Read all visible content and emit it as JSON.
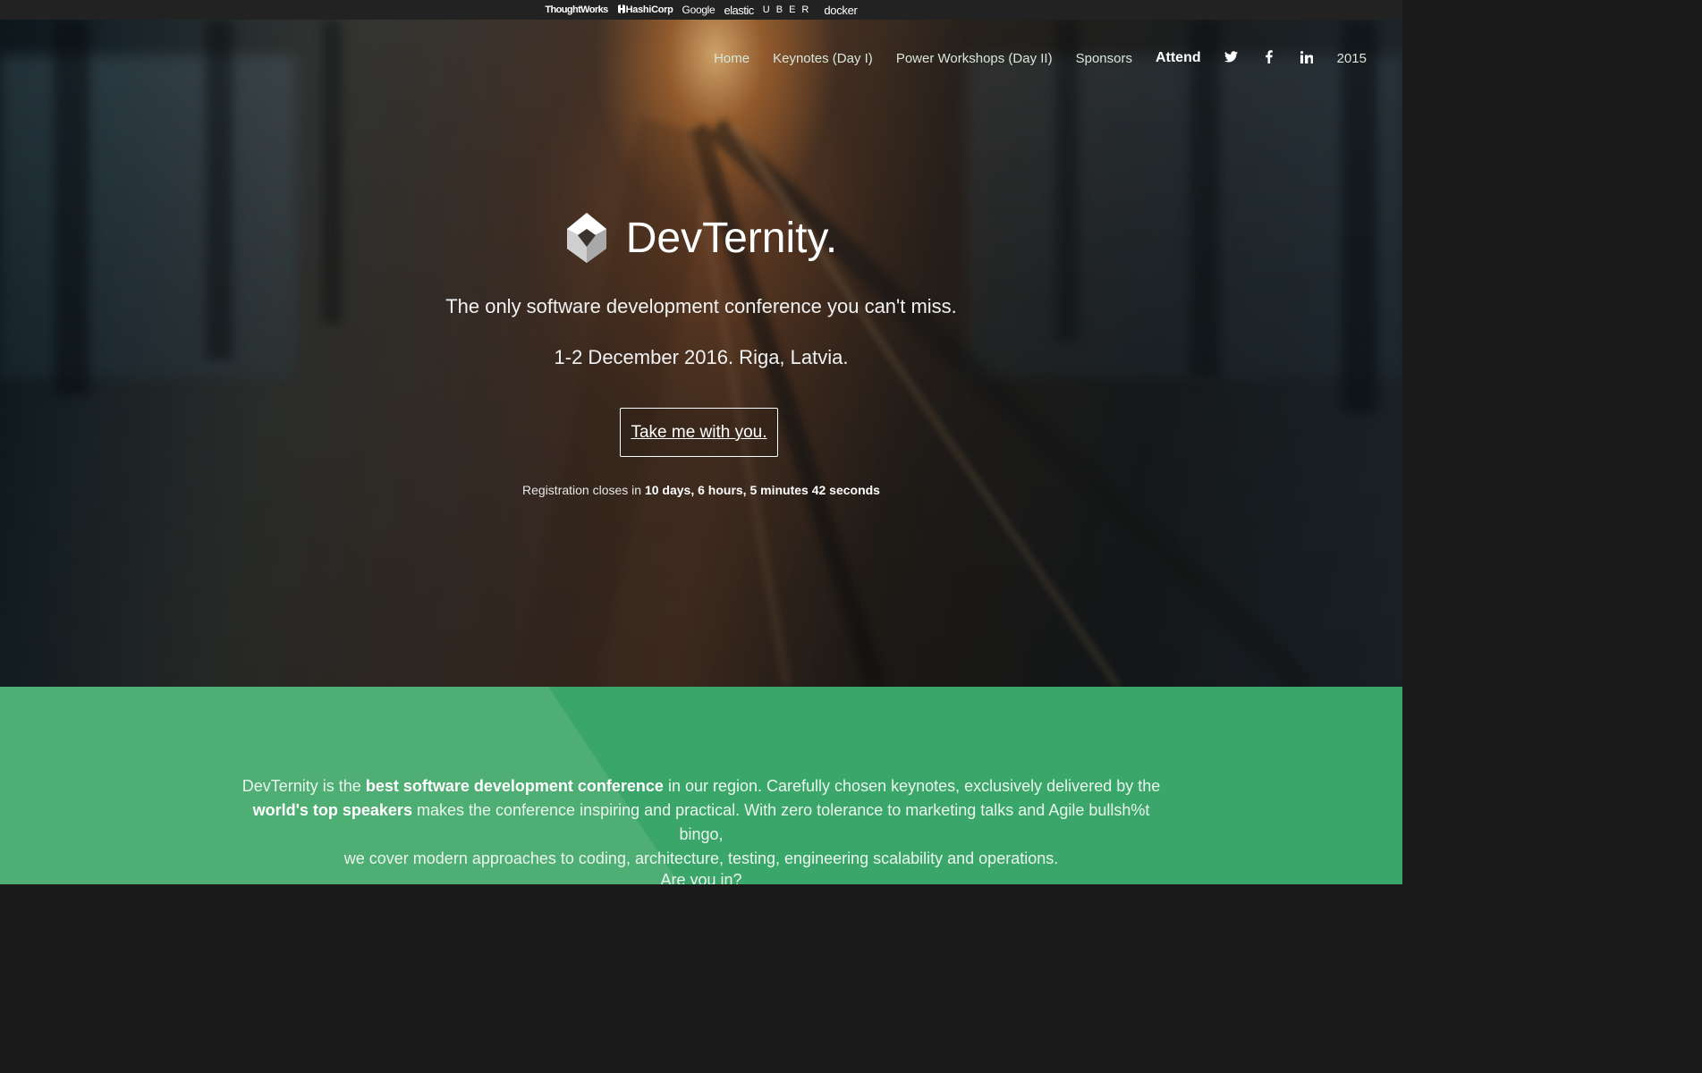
{
  "sponsors": {
    "thoughtworks": "ThoughtWorks",
    "hashicorp": "HashiCorp",
    "google": "Google",
    "elastic": "elastic",
    "uber": "UBER",
    "docker": "docker"
  },
  "nav": {
    "home": "Home",
    "keynotes": "Keynotes (Day I)",
    "workshops": "Power Workshops (Day II)",
    "sponsors": "Sponsors",
    "attend": "Attend",
    "twitter_icon": "twitter-icon",
    "facebook_icon": "facebook-icon",
    "linkedin_icon": "linkedin-icon",
    "year_2015": "2015"
  },
  "hero": {
    "brand": "DevTernity.",
    "tagline": "The only software development conference you can't miss.",
    "dates": "1-2 December 2016. Riga, Latvia.",
    "cta": "Take me with you.",
    "registration_prefix": "Registration closes in",
    "registration_countdown": "10 days, 6 hours, 5 minutes 42 seconds"
  },
  "about": {
    "p1_a": "DevTernity is the",
    "p1_bold": "best software development conference",
    "p1_b": "in our region. Carefully chosen keynotes, exclusively delivered by the",
    "p2_bold": "world's top speakers",
    "p2_a": "makes the conference inspiring and practical. With zero tolerance to marketing talks and Agile bullsh%t bingo,",
    "p3": "we cover modern approaches to coding, architecture, testing, engineering scalability and operations.",
    "question": "Are you in?"
  },
  "colors": {
    "green": "#3ba66a",
    "green_light": "#4eae74",
    "sponsor_bar": "#222222"
  }
}
